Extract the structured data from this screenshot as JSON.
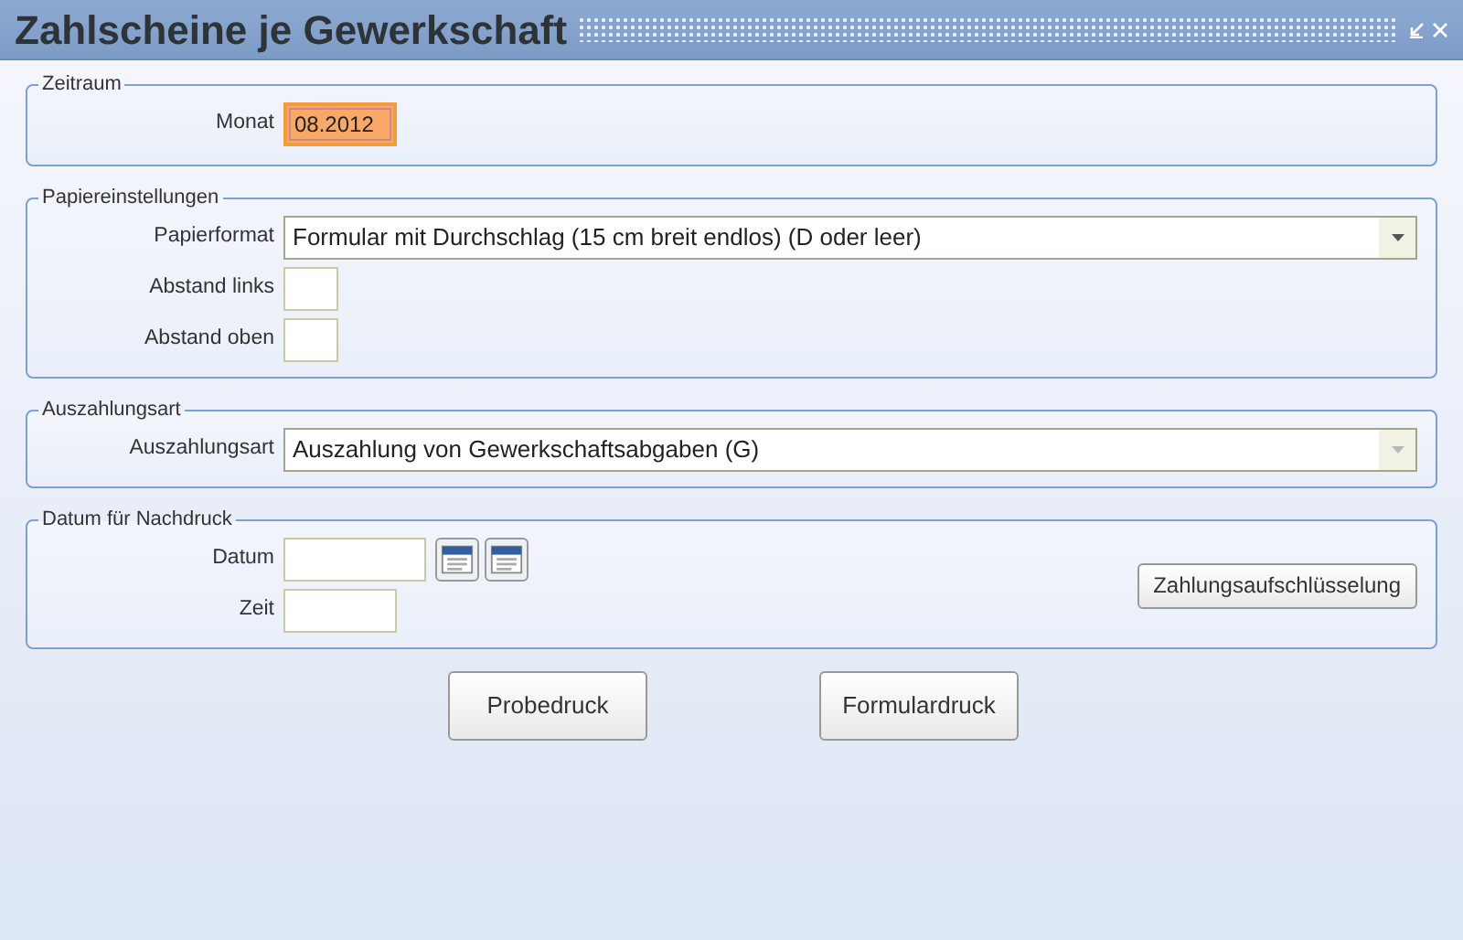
{
  "window": {
    "title": "Zahlscheine je Gewerkschaft"
  },
  "sections": [
    {
      "legend": "Zeitraum",
      "fields": [
        {
          "kind": "text",
          "label": "Monat",
          "value": "08.2012",
          "highlighted": true
        }
      ]
    },
    {
      "legend": "Papiereinstellungen",
      "fields": [
        {
          "kind": "select",
          "label": "Papierformat",
          "value": "Formular mit Durchschlag (15 cm breit endlos) (D oder leer)",
          "disabled": false
        },
        {
          "kind": "narrow",
          "label": "Abstand links",
          "highlighted": false
        },
        {
          "kind": "narrow",
          "label": "Abstand oben",
          "highlighted": false
        }
      ]
    },
    {
      "legend": "Auszahlungsart",
      "fields": [
        {
          "kind": "select",
          "label": "Auszahlungsart",
          "value": "Auszahlung von Gewerkschaftsabgaben (G)",
          "disabled": true
        }
      ]
    },
    {
      "legend": "Datum für Nachdruck",
      "fields": [
        {
          "kind": "date",
          "label": "Datum"
        },
        {
          "kind": "text",
          "label": "Zeit",
          "highlighted": false
        }
      ],
      "side_button": "Zahlungsaufschlüsselung"
    }
  ],
  "buttons": [
    "Probedruck",
    "Formulardruck"
  ]
}
